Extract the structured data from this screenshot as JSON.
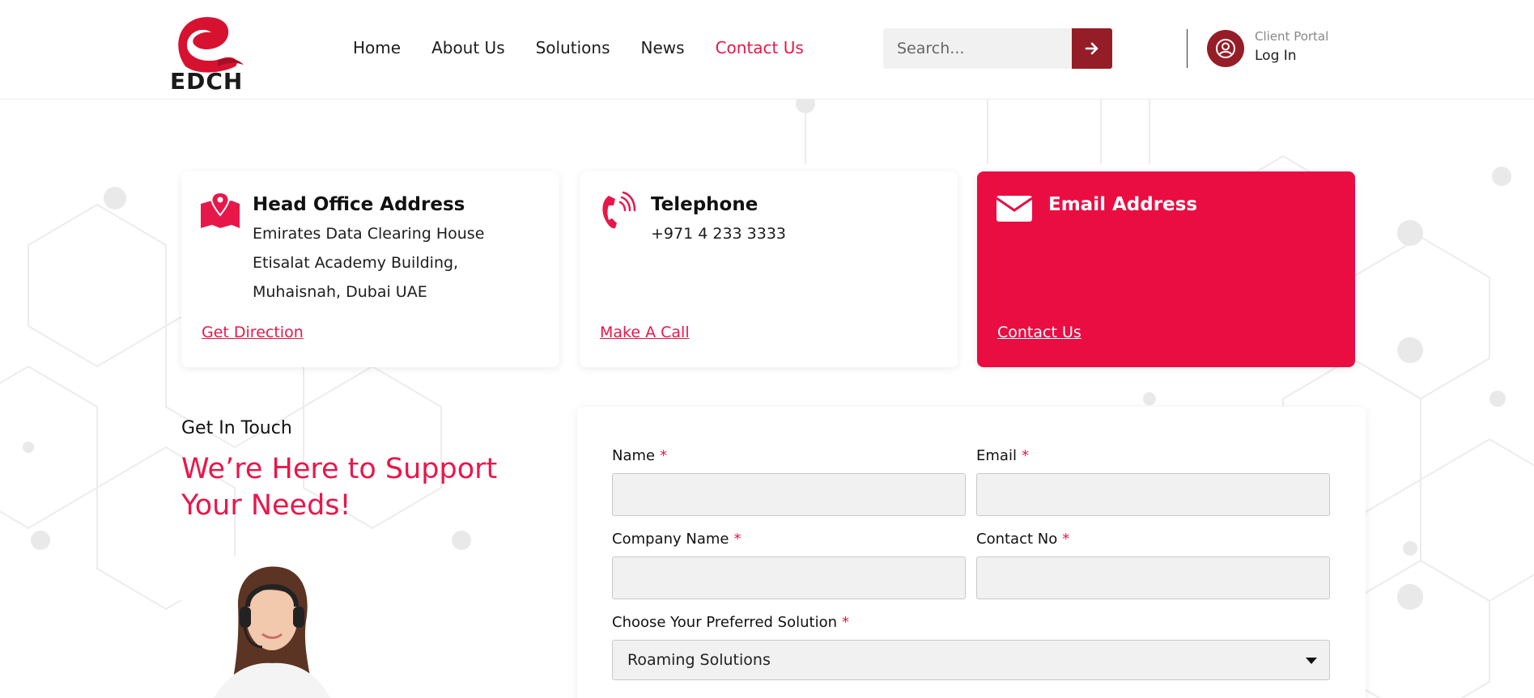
{
  "brand": {
    "logo_text": "EDCH",
    "accent": "#e8174a",
    "dark_red": "#951d27"
  },
  "nav": {
    "items": [
      {
        "label": "Home",
        "active": false
      },
      {
        "label": "About Us",
        "active": false
      },
      {
        "label": "Solutions",
        "active": false
      },
      {
        "label": "News",
        "active": false
      },
      {
        "label": "Contact Us",
        "active": true
      }
    ]
  },
  "search": {
    "placeholder": "Search...",
    "button_icon": "arrow-right-icon"
  },
  "portal": {
    "small_label": "Client Portal",
    "login_label": "Log In",
    "icon": "user-circle-icon"
  },
  "cards": [
    {
      "icon": "map-pin-icon",
      "title": "Head Office Address",
      "lines": [
        "Emirates Data Clearing House",
        "Etisalat Academy Building,",
        "Muhaisnah, Dubai UAE"
      ],
      "link": "Get Direction"
    },
    {
      "icon": "phone-icon",
      "title": "Telephone",
      "lines": [
        "+971 4 233 3333"
      ],
      "link": "Make A Call"
    },
    {
      "icon": "envelope-icon",
      "title": "Email Address",
      "lines": [],
      "link": "Contact Us"
    }
  ],
  "touch": {
    "label": "Get In Touch",
    "heading": "We’re Here to Support Your Needs!"
  },
  "form": {
    "name_label": "Name",
    "email_label": "Email",
    "company_label": "Company Name",
    "contact_label": "Contact No",
    "solution_label": "Choose Your Preferred Solution",
    "solution_value": "Roaming Solutions",
    "required_mark": "*",
    "name_value": "",
    "email_value": "",
    "company_value": "",
    "contact_value": ""
  }
}
